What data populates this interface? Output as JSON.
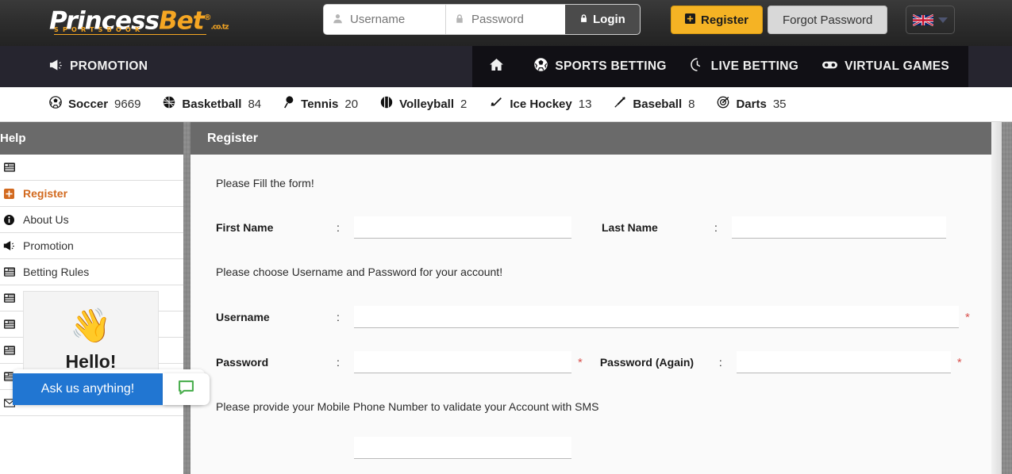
{
  "header": {
    "logo": {
      "part1": "Princess",
      "part2": "Bet",
      "registered": "®",
      "dotcom": ".co.tz",
      "tagline": "SPORTSBOOK"
    },
    "login": {
      "username_placeholder": "Username",
      "password_placeholder": "Password",
      "username_value": "",
      "password_value": "",
      "login_label": "Login"
    },
    "register_label": "Register",
    "forgot_label": "Forgot Password",
    "language": "English (UK)"
  },
  "nav": {
    "promotion_label": "PROMOTION",
    "right_items": [
      {
        "label": "",
        "icon": "home-icon"
      },
      {
        "label": "SPORTS BETTING",
        "icon": "soccer-ball-icon"
      },
      {
        "label": "LIVE BETTING",
        "icon": "clock-icon"
      },
      {
        "label": "VIRTUAL GAMES",
        "icon": "gamepad-icon"
      }
    ]
  },
  "sports": [
    {
      "name": "Soccer",
      "count": "9669",
      "icon": "soccer-ball-icon"
    },
    {
      "name": "Basketball",
      "count": "84",
      "icon": "basketball-icon"
    },
    {
      "name": "Tennis",
      "count": "20",
      "icon": "tennis-racquet-icon"
    },
    {
      "name": "Volleyball",
      "count": "2",
      "icon": "volleyball-icon"
    },
    {
      "name": "Ice Hockey",
      "count": "13",
      "icon": "hockey-stick-icon"
    },
    {
      "name": "Baseball",
      "count": "8",
      "icon": "baseball-bat-icon"
    },
    {
      "name": "Darts",
      "count": "35",
      "icon": "dartboard-icon"
    }
  ],
  "sidebar": {
    "title": "Help",
    "items": [
      {
        "label": "",
        "icon": "list-alt-icon",
        "active": false
      },
      {
        "label": "Register",
        "icon": "plus-square-icon",
        "active": true
      },
      {
        "label": "About Us",
        "icon": "info-circle-icon",
        "active": false
      },
      {
        "label": "Promotion",
        "icon": "bullhorn-icon",
        "active": false
      },
      {
        "label": "Betting Rules",
        "icon": "list-alt-icon",
        "active": false
      },
      {
        "label": "",
        "icon": "list-alt-icon",
        "active": false
      },
      {
        "label": "",
        "icon": "list-alt-icon",
        "active": false
      },
      {
        "label": "",
        "icon": "list-alt-icon",
        "active": false
      },
      {
        "label": "",
        "icon": "list-alt-icon",
        "active": false
      },
      {
        "label": "",
        "icon": "envelope-icon",
        "active": false
      }
    ]
  },
  "panel": {
    "title": "Register",
    "intro": "Please Fill the form!",
    "section_credentials": "Please choose Username and Password for your account!",
    "section_phone": "Please provide your Mobile Phone Number to validate your Account with SMS",
    "colon": ":",
    "required_mark": "*",
    "fields": {
      "first_name": {
        "label": "First Name",
        "value": ""
      },
      "last_name": {
        "label": "Last Name",
        "value": ""
      },
      "username": {
        "label": "Username",
        "value": ""
      },
      "password": {
        "label": "Password",
        "value": ""
      },
      "password_again": {
        "label": "Password (Again)",
        "value": ""
      }
    }
  },
  "chat": {
    "wave_emoji": "👋",
    "greeting": "Hello!",
    "cta": "Ask us anything!"
  },
  "colors": {
    "brand_yellow": "#f5b324",
    "accent_orange": "#d2691e",
    "panel_header_gray": "#6a6a6a",
    "nav_dark": "#26252f",
    "chat_blue": "#2176d2",
    "chat_green": "#4caf50",
    "required_red": "#d9534f"
  }
}
